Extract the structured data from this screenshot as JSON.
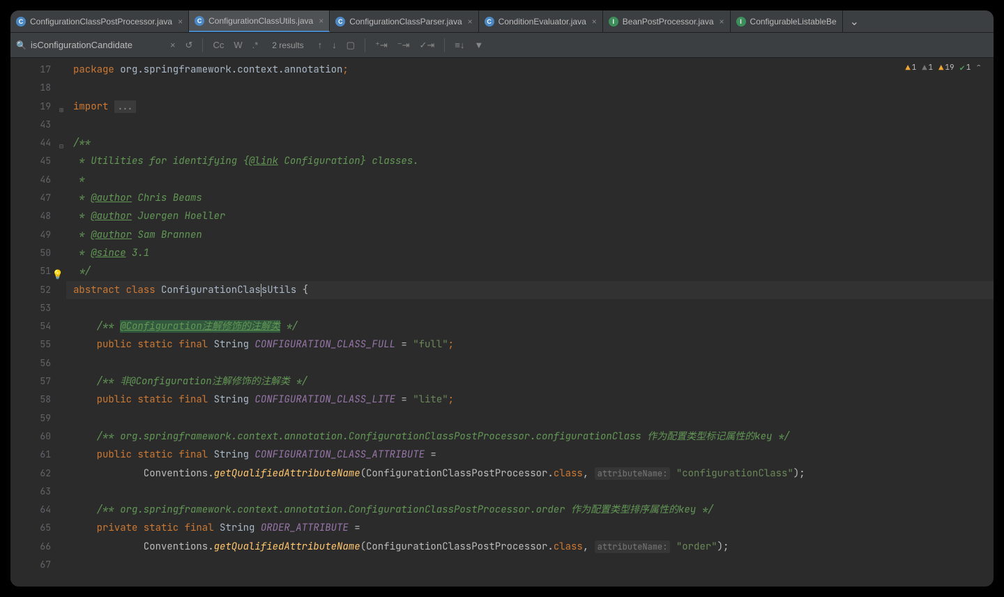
{
  "tabs": [
    {
      "icon": "C",
      "iconClass": "c",
      "name": "ConfigurationClassPostProcessor.java",
      "active": false
    },
    {
      "icon": "C",
      "iconClass": "c",
      "name": "ConfigurationClassUtils.java",
      "active": true
    },
    {
      "icon": "C",
      "iconClass": "c",
      "name": "ConfigurationClassParser.java",
      "active": false
    },
    {
      "icon": "C",
      "iconClass": "c",
      "name": "ConditionEvaluator.java",
      "active": false
    },
    {
      "icon": "I",
      "iconClass": "i",
      "name": "BeanPostProcessor.java",
      "active": false
    },
    {
      "icon": "I",
      "iconClass": "i",
      "name": "ConfigurableListableBe",
      "active": false
    }
  ],
  "find": {
    "value": "isConfigurationCandidate",
    "results": "2 results",
    "cc": "Cc",
    "w": "W"
  },
  "inspections": {
    "warn1": "1",
    "warn2": "1",
    "warn3": "19",
    "ok": "1"
  },
  "lines": [
    {
      "n": "17"
    },
    {
      "n": "18"
    },
    {
      "n": "19"
    },
    {
      "n": "43"
    },
    {
      "n": "44"
    },
    {
      "n": "45"
    },
    {
      "n": "46"
    },
    {
      "n": "47"
    },
    {
      "n": "48"
    },
    {
      "n": "49"
    },
    {
      "n": "50"
    },
    {
      "n": "51"
    },
    {
      "n": "52"
    },
    {
      "n": "53"
    },
    {
      "n": "54"
    },
    {
      "n": "55"
    },
    {
      "n": "56"
    },
    {
      "n": "57"
    },
    {
      "n": "58"
    },
    {
      "n": "59"
    },
    {
      "n": "60"
    },
    {
      "n": "61"
    },
    {
      "n": "62"
    },
    {
      "n": "63"
    },
    {
      "n": "64"
    },
    {
      "n": "65"
    },
    {
      "n": "66"
    },
    {
      "n": "67"
    }
  ],
  "code": {
    "l17_pkg": "package ",
    "l17_path": "org.springframework.context.annotation",
    "l17_semi": ";",
    "l19_imp": "import ",
    "l19_fold": "...",
    "l44": "/**",
    "l45_a": " * Utilities for identifying ",
    "l45_b": "{",
    "l45_c": "@link",
    "l45_d": " Configuration",
    "l45_e": "}",
    "l45_f": " classes.",
    "l46": " *",
    "l47_a": " * ",
    "l47_b": "@author",
    "l47_c": " Chris Beams",
    "l48_a": " * ",
    "l48_b": "@author",
    "l48_c": " Juergen Hoeller",
    "l49_a": " * ",
    "l49_b": "@author",
    "l49_c": " Sam Brannen",
    "l50_a": " * ",
    "l50_b": "@since",
    "l50_c": " 3.1",
    "l51": " */",
    "l52_a": "abstract class ",
    "l52_b": "ConfigurationClas",
    "l52_c": "sUtils",
    "l52_d": " {",
    "l54_a": "    /** ",
    "l54_b": "@Configuration注解修饰的注解类",
    "l54_c": " */",
    "l55_a": "    ",
    "l55_b": "public static final ",
    "l55_c": "String ",
    "l55_d": "CONFIGURATION_CLASS_FULL",
    "l55_e": " = ",
    "l55_f": "\"full\"",
    "l55_g": ";",
    "l57": "    /** 非@Configuration注解修饰的注解类 */",
    "l58_a": "    ",
    "l58_b": "public static final ",
    "l58_c": "String ",
    "l58_d": "CONFIGURATION_CLASS_LITE",
    "l58_e": " = ",
    "l58_f": "\"lite\"",
    "l58_g": ";",
    "l60": "    /** org.springframework.context.annotation.ConfigurationClassPostProcessor.configurationClass 作为配置类型标记属性的key */",
    "l61_a": "    ",
    "l61_b": "public static final ",
    "l61_c": "String ",
    "l61_d": "CONFIGURATION_CLASS_ATTRIBUTE",
    "l61_e": " =",
    "l62_a": "            Conventions.",
    "l62_b": "getQualifiedAttributeName",
    "l62_c": "(ConfigurationClassPostProcessor.",
    "l62_d": "class",
    "l62_e": ", ",
    "l62_f": "attributeName:",
    "l62_g": " ",
    "l62_h": "\"configurationClass\"",
    "l62_i": ");",
    "l64": "    /** org.springframework.context.annotation.ConfigurationClassPostProcessor.order 作为配置类型排序属性的key */",
    "l65_a": "    ",
    "l65_b": "private static final ",
    "l65_c": "String ",
    "l65_d": "ORDER_ATTRIBUTE",
    "l65_e": " =",
    "l66_a": "            Conventions.",
    "l66_b": "getQualifiedAttributeName",
    "l66_c": "(ConfigurationClassPostProcessor.",
    "l66_d": "class",
    "l66_e": ", ",
    "l66_f": "attributeName:",
    "l66_g": " ",
    "l66_h": "\"order\"",
    "l66_i": ");"
  }
}
